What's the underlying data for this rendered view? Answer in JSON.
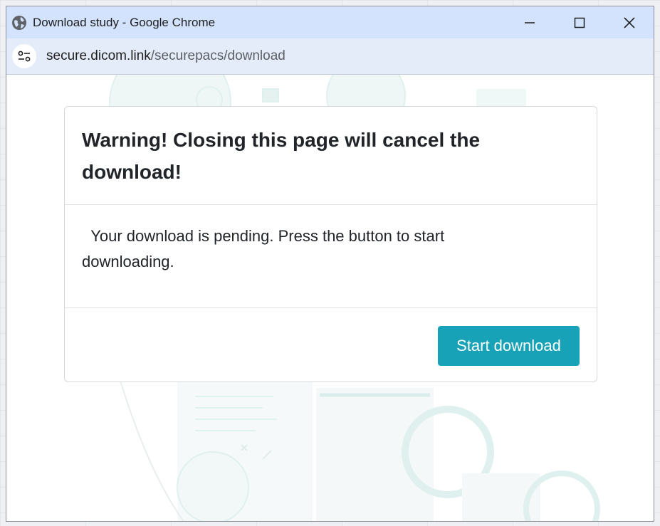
{
  "window": {
    "title": "Download study - Google Chrome",
    "icons": {
      "site": "globe-icon",
      "minimize": "minimize-icon",
      "maximize": "maximize-icon",
      "close": "close-icon"
    }
  },
  "address_bar": {
    "site_info_icon": "tune-icon",
    "domain": "secure.dicom.link",
    "path": "/securepacs/download"
  },
  "dialog": {
    "title": "Warning! Closing this page will cancel the download!",
    "message": "  Your download is pending. Press the button to start downloading.",
    "button_label": "Start download",
    "button_color": "#17a2b8"
  },
  "colors": {
    "titlebar": "#d3e3fd",
    "addressbar": "#e4ecfa",
    "text": "#212529"
  }
}
